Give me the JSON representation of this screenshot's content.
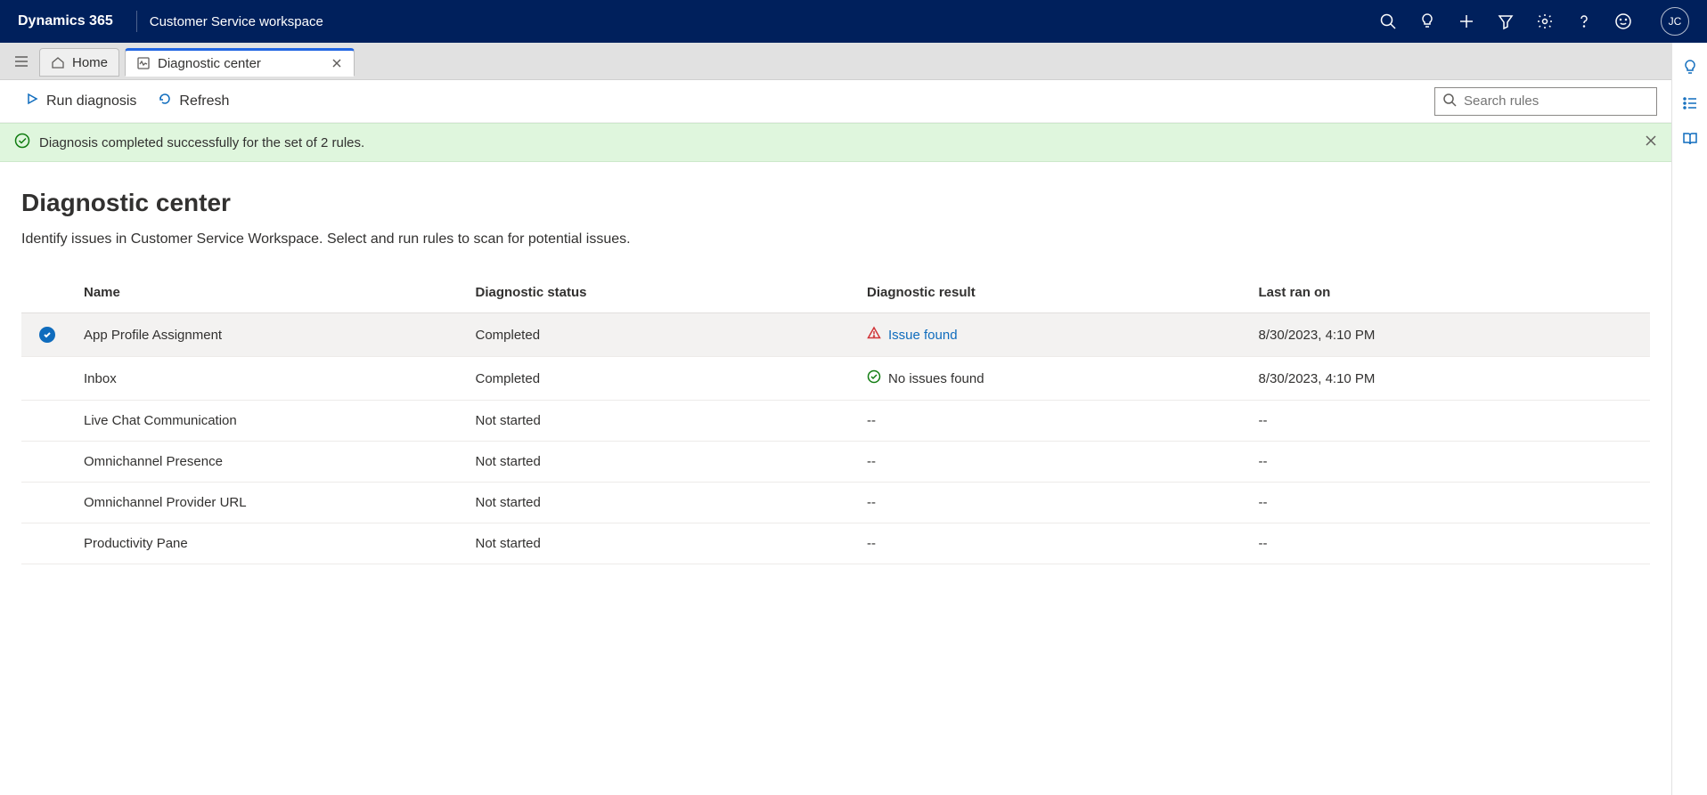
{
  "header": {
    "brand": "Dynamics 365",
    "workspace": "Customer Service workspace",
    "avatar_initials": "JC"
  },
  "tabs": {
    "home_label": "Home",
    "active_label": "Diagnostic center"
  },
  "commands": {
    "run_diagnosis": "Run diagnosis",
    "refresh": "Refresh"
  },
  "search": {
    "placeholder": "Search rules"
  },
  "notification": {
    "message": "Diagnosis completed successfully for the set of 2 rules."
  },
  "page": {
    "title": "Diagnostic center",
    "subtitle": "Identify issues in Customer Service Workspace. Select and run rules to scan for potential issues."
  },
  "table": {
    "columns": {
      "name": "Name",
      "status": "Diagnostic status",
      "result": "Diagnostic result",
      "last_ran": "Last ran on"
    },
    "rows": [
      {
        "selected": true,
        "name": "App Profile Assignment",
        "status": "Completed",
        "result_type": "issue",
        "result": "Issue found",
        "last_ran": "8/30/2023, 4:10 PM"
      },
      {
        "selected": false,
        "name": "Inbox",
        "status": "Completed",
        "result_type": "ok",
        "result": "No issues found",
        "last_ran": "8/30/2023, 4:10 PM"
      },
      {
        "selected": false,
        "name": "Live Chat Communication",
        "status": "Not started",
        "result_type": "none",
        "result": "--",
        "last_ran": "--"
      },
      {
        "selected": false,
        "name": "Omnichannel Presence",
        "status": "Not started",
        "result_type": "none",
        "result": "--",
        "last_ran": "--"
      },
      {
        "selected": false,
        "name": "Omnichannel Provider URL",
        "status": "Not started",
        "result_type": "none",
        "result": "--",
        "last_ran": "--"
      },
      {
        "selected": false,
        "name": "Productivity Pane",
        "status": "Not started",
        "result_type": "none",
        "result": "--",
        "last_ran": "--"
      }
    ]
  }
}
